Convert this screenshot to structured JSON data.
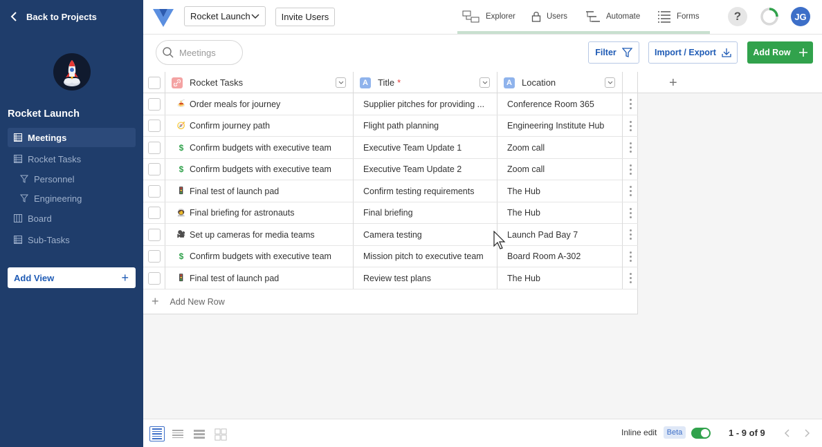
{
  "sidebar": {
    "back_label": "Back to Projects",
    "project_name": "Rocket Launch",
    "items": [
      {
        "label": "Meetings",
        "icon": "table-icon",
        "active": true
      },
      {
        "label": "Rocket Tasks",
        "icon": "table-icon",
        "active": false
      },
      {
        "label": "Personnel",
        "icon": "filter-icon",
        "active": false
      },
      {
        "label": "Engineering",
        "icon": "filter-icon",
        "active": false
      },
      {
        "label": "Board",
        "icon": "board-icon",
        "active": false
      },
      {
        "label": "Sub-Tasks",
        "icon": "table-icon",
        "active": false
      }
    ],
    "add_view_label": "Add View"
  },
  "header": {
    "project_select": "Rocket Launch",
    "invite_label": "Invite Users",
    "tabs": [
      {
        "label": "Explorer",
        "icon": "explorer-icon"
      },
      {
        "label": "Users",
        "icon": "lock-icon"
      },
      {
        "label": "Automate",
        "icon": "automate-icon"
      },
      {
        "label": "Forms",
        "icon": "forms-icon"
      }
    ],
    "help_label": "?",
    "avatar_initials": "JG"
  },
  "toolbar": {
    "search_placeholder": "Meetings",
    "filter_label": "Filter",
    "import_export_label": "Import / Export",
    "add_row_label": "Add Row"
  },
  "table": {
    "columns": [
      {
        "label": "Rocket Tasks",
        "type_icon": "link-icon",
        "badge_color": "#f4a3a3"
      },
      {
        "label": "Title",
        "type_icon": "A",
        "badge_color": "#8fb3ec",
        "required_mark": "*"
      },
      {
        "label": "Location",
        "type_icon": "A",
        "badge_color": "#8fb3ec"
      }
    ],
    "rows": [
      {
        "task": "Order meals for journey",
        "task_icon": "🍝",
        "title": "Supplier pitches for providing ...",
        "location": "Conference Room 365"
      },
      {
        "task": "Confirm journey path",
        "task_icon": "🧭",
        "title": "Flight path planning",
        "location": "Engineering Institute Hub"
      },
      {
        "task": "Confirm budgets with executive team",
        "task_icon": "$",
        "title": "Executive Team Update 1",
        "location": "Zoom call"
      },
      {
        "task": "Confirm budgets with executive team",
        "task_icon": "$",
        "title": "Executive Team Update 2",
        "location": "Zoom call"
      },
      {
        "task": "Final test of launch pad",
        "task_icon": "🚦",
        "title": "Confirm testing requirements",
        "location": "The Hub"
      },
      {
        "task": "Final briefing for astronauts",
        "task_icon": "🧑‍🚀",
        "title": "Final briefing",
        "location": "The Hub"
      },
      {
        "task": "Set up cameras for media teams",
        "task_icon": "🎥",
        "title": "Camera testing",
        "location": "Launch Pad Bay 7"
      },
      {
        "task": "Confirm budgets with executive team",
        "task_icon": "$",
        "title": "Mission pitch to executive team",
        "location": "Board Room A-302"
      },
      {
        "task": "Final test of launch pad",
        "task_icon": "🚦",
        "title": "Review test plans",
        "location": "The Hub"
      }
    ],
    "add_new_row_label": "Add New Row"
  },
  "footer": {
    "inline_edit_label": "Inline edit",
    "beta_label": "Beta",
    "inline_edit_on": true,
    "paging": "1 - 9 of 9"
  },
  "colors": {
    "sidebar_bg": "#1f3d6b",
    "accent_blue": "#1f5bb5",
    "add_row_green": "#31a24c"
  }
}
